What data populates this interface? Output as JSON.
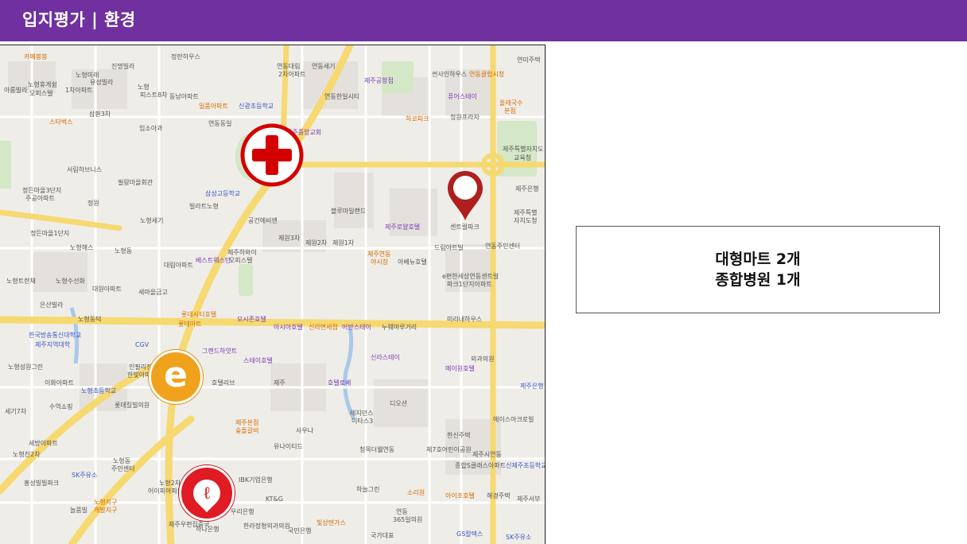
{
  "header": {
    "title": "입지평가 | 환경"
  },
  "summary": {
    "lines": [
      "대형마트 2개",
      "종합병원 1개"
    ]
  },
  "map": {
    "markers": [
      {
        "name": "hospital-icon",
        "kind": "종합병원",
        "color": "#d40000"
      },
      {
        "name": "location-pin-icon",
        "kind": "사업지",
        "color": "#b01e1e"
      },
      {
        "name": "emart-logo",
        "glyph": "e",
        "color": "#f0a21c"
      },
      {
        "name": "lotte-mart-logo",
        "glyph": "ℓ",
        "color": "#e01b24"
      }
    ],
    "labels": [
      "카페봉봉",
      "진명빌라",
      "정란하우스",
      "노형미래",
      "유성빌라",
      "1차아파트",
      "아름빌라",
      "노형휴게쉼",
      "오피스텔",
      "노형",
      "피스트8차",
      "동남아파트",
      "일품아파트",
      "신광초등학교",
      "연동대림",
      "2차아파트",
      "연동세기",
      "연동한일시티",
      "제주공항점",
      "썬사인하우스",
      "연동클럽시청",
      "연미주택",
      "스타벅스",
      "삼환3차",
      "퓨어스테이",
      "올레국수",
      "본점",
      "임소아과",
      "연동동일",
      "제주중앙교회",
      "하코파크",
      "정원프라자",
      "제주특별자치도",
      "교육청",
      "제주은행",
      "제주특별",
      "자치도청",
      "서림하브니스",
      "필랑마을회관",
      "삼성고등학교",
      "빌라트노형",
      "정든마을3단지",
      "주공아파트",
      "정원",
      "노형세기",
      "공건에비앤",
      "제원3차",
      "제원2차",
      "제원1차",
      "블루마일랜드",
      "제주로얄호텔",
      "센트럴파크",
      "드림아트빌",
      "연동주민센터",
      "정든마을1단지",
      "노형해스",
      "노형동",
      "대림아파트",
      "베스트웨스턴",
      "제주하와이",
      "오피스텔",
      "제주연동",
      "야시장",
      "아베뉴호텔",
      "e편한세상연동센트럴",
      "파크1단지아파트",
      "노형트란채",
      "노형수선화",
      "대원아파트",
      "세마을금고",
      "롯데시티호텔",
      "노형동덕",
      "은산빌라",
      "롯데마트",
      "모시존호텔",
      "아시아호텔",
      "신라면세점",
      "어반스테이",
      "누웨마루거리",
      "미리내하우스",
      "한국방송통신대학교",
      "제주지역대학",
      "CGV",
      "그랜드하얏트",
      "스테이호텔",
      "인필리전트",
      "한빛아파트",
      "호텔리브",
      "신라스테이",
      "메이원호텔",
      "외과의원",
      "노형성원그린",
      "이화아파트",
      "제주",
      "노형초등학교",
      "호텔로베",
      "레지던스",
      "이타스3",
      "디오션",
      "제주은행",
      "세기7차",
      "수역쇼핑",
      "롯데킬빌의원",
      "제주본점",
      "숲돌갈비",
      "유나이티드",
      "사우나",
      "한신주택",
      "에이스아크로빌",
      "노형진2차",
      "세방아파트",
      "노형동",
      "주민센터",
      "SK주유소",
      "청목더웰연동",
      "제7호어린이공원",
      "제주시연동",
      "종합S클래스아파트",
      "신제주초등학교",
      "홍성빌빌파크",
      "노형2차",
      "어이피아파트",
      "하늘그린",
      "소리원",
      "아이조호텔",
      "해경주택",
      "제주서부",
      "늘품빌",
      "노형지구",
      "개발지구",
      "IBK기업은행",
      "KT&G",
      "우리은행",
      "연동",
      "365일의원",
      "GS칼텍스",
      "제주우편집중국",
      "하나은행",
      "한라정형외과의원",
      "국민은행",
      "빛상텐가스",
      "국가대표",
      "SK주유소"
    ]
  }
}
